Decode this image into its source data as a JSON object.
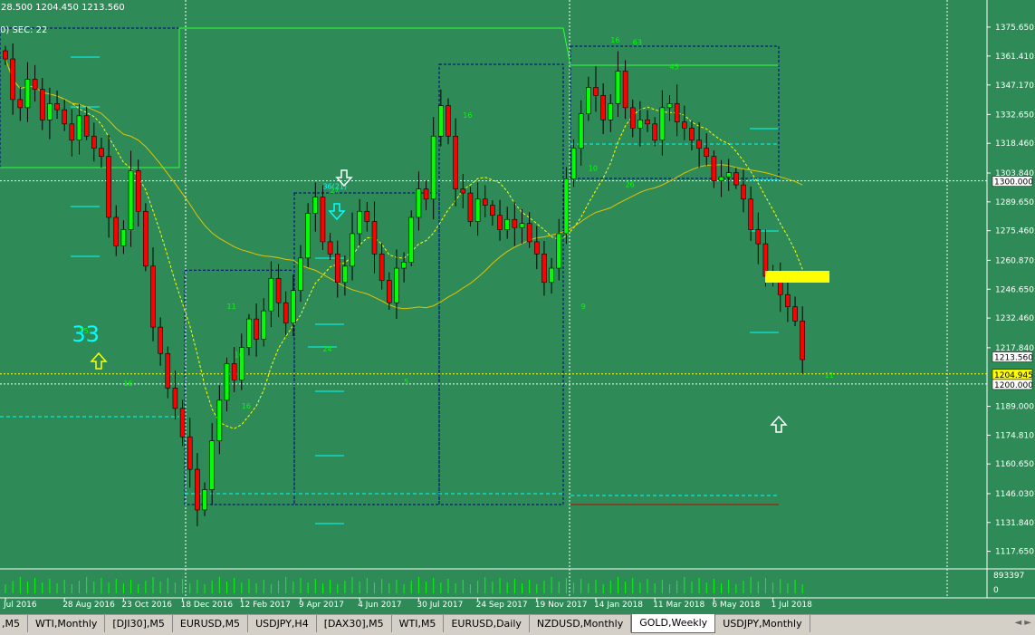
{
  "window": {
    "info_line": "28.500 1204.450 1213.560",
    "sec_label": "0)  SEC: 22"
  },
  "colors": {
    "background": "#2e8b57",
    "bull": "#00ff00",
    "bear": "#ff0000",
    "ma": "#ffff00",
    "channel": "#000080",
    "cyan_lines": "#00ffff",
    "green_lines": "#32ff32",
    "price_tag_yellow": "#ffff00"
  },
  "tabs": [
    {
      "label": ",M5",
      "active": false
    },
    {
      "label": "WTI,Monthly",
      "active": false
    },
    {
      "label": "[DJI30],M5",
      "active": false
    },
    {
      "label": "EURUSD,M5",
      "active": false
    },
    {
      "label": "USDJPY,H4",
      "active": false
    },
    {
      "label": "[DAX30],M5",
      "active": false
    },
    {
      "label": "WTI,M5",
      "active": false
    },
    {
      "label": "EURUSD,Daily",
      "active": false
    },
    {
      "label": "NZDUSD,Monthly",
      "active": false
    },
    {
      "label": "GOLD,Weekly",
      "active": true
    },
    {
      "label": "USDJPY,Monthly",
      "active": false
    }
  ],
  "scroll_arrows": "◄ ►",
  "chart_data": {
    "type": "candlestick",
    "symbol": "GOLD",
    "timeframe": "Weekly",
    "ylim": [
      1109,
      1389
    ],
    "y_ticks": [
      1375.65,
      1361.41,
      1347.17,
      1332.65,
      1318.46,
      1303.84,
      1289.65,
      1275.46,
      1260.87,
      1246.65,
      1232.46,
      1217.84,
      1189.0,
      1174.81,
      1160.65,
      1146.03,
      1131.84,
      1117.65
    ],
    "y_tick_labels": [
      "1375.650",
      "1361.410",
      "1347.170",
      "1332.650",
      "1318.460",
      "1303.840",
      "1289.650",
      "1275.460",
      "1260.870",
      "1246.650",
      "1232.460",
      "1217.840",
      "1189.000",
      "1174.810",
      "1160.650",
      "1146.030",
      "1131.840",
      "1117.650"
    ],
    "price_tags": [
      {
        "price": 1300.0,
        "label": "1300.000",
        "style": "white"
      },
      {
        "price": 1213.56,
        "label": "1213.560",
        "style": "white"
      },
      {
        "price": 1204.945,
        "label": "1204.945",
        "style": "yellow"
      },
      {
        "price": 1200.0,
        "label": "1200.000",
        "style": "white"
      }
    ],
    "x_labels": [
      {
        "bar": 0,
        "text": "Jul 2016"
      },
      {
        "bar": 8,
        "text": "28 Aug 2016"
      },
      {
        "bar": 16,
        "text": "23 Oct 2016"
      },
      {
        "bar": 24,
        "text": "18 Dec 2016"
      },
      {
        "bar": 32,
        "text": "12 Feb 2017"
      },
      {
        "bar": 40,
        "text": "9 Apr 2017"
      },
      {
        "bar": 48,
        "text": "4 Jun 2017"
      },
      {
        "bar": 56,
        "text": "30 Jul 2017"
      },
      {
        "bar": 64,
        "text": "24 Sep 2017"
      },
      {
        "bar": 72,
        "text": "19 Nov 2017"
      },
      {
        "bar": 80,
        "text": "14 Jan 2018"
      },
      {
        "bar": 88,
        "text": "11 Mar 2018"
      },
      {
        "bar": 96,
        "text": "6 May 2018"
      },
      {
        "bar": 104,
        "text": "1 Jul 2018"
      }
    ],
    "close_prices": [
      1360,
      1340,
      1336,
      1350,
      1345,
      1330,
      1338,
      1335,
      1328,
      1320,
      1332,
      1322,
      1316,
      1312,
      1282,
      1268,
      1276,
      1305,
      1285,
      1258,
      1228,
      1215,
      1198,
      1188,
      1174,
      1158,
      1138,
      1148,
      1172,
      1192,
      1210,
      1202,
      1218,
      1232,
      1222,
      1236,
      1252,
      1240,
      1230,
      1246,
      1262,
      1284,
      1292,
      1270,
      1264,
      1250,
      1258,
      1274,
      1285,
      1280,
      1264,
      1251,
      1240,
      1257,
      1260,
      1282,
      1296,
      1291,
      1322,
      1337,
      1322,
      1296,
      1294,
      1280,
      1291,
      1288,
      1283,
      1276,
      1281,
      1277,
      1279,
      1270,
      1264,
      1250,
      1257,
      1274,
      1301,
      1316,
      1333,
      1346,
      1342,
      1330,
      1338,
      1354,
      1336,
      1326,
      1330,
      1328,
      1320,
      1336,
      1338,
      1329,
      1326,
      1320,
      1316,
      1312,
      1300,
      1302,
      1304,
      1298,
      1291,
      1276,
      1269,
      1253,
      1252,
      1244,
      1238,
      1231,
      1212
    ],
    "volume_label": "893397",
    "volume_zero_label": "0",
    "annotations": [
      {
        "text": "33",
        "bar": 9,
        "price": 1221
      },
      {
        "text": "36(21)",
        "bar": 43,
        "price": 1296
      },
      {
        "text": "16",
        "bar": 82,
        "price": 1368
      },
      {
        "text": "63",
        "bar": 85,
        "price": 1367
      },
      {
        "text": "45",
        "bar": 90,
        "price": 1355
      },
      {
        "text": "16",
        "bar": 62,
        "price": 1331
      },
      {
        "text": "10",
        "bar": 79,
        "price": 1305
      },
      {
        "text": "26",
        "bar": 84,
        "price": 1297
      },
      {
        "text": "11",
        "bar": 30,
        "price": 1237
      },
      {
        "text": "10",
        "bar": 31,
        "price": 1213
      },
      {
        "text": "24",
        "bar": 43,
        "price": 1216
      },
      {
        "text": "16",
        "bar": 32,
        "price": 1188
      },
      {
        "text": "9",
        "bar": 78,
        "price": 1237
      },
      {
        "text": "5",
        "bar": 54,
        "price": 1200
      },
      {
        "text": "11",
        "bar": 111,
        "price": 1203
      },
      {
        "text": "25",
        "bar": 10,
        "price": 1225
      },
      {
        "text": "16",
        "bar": 16,
        "price": 1199
      },
      {
        "text": "27",
        "bar": 44,
        "price": 1294
      }
    ]
  }
}
